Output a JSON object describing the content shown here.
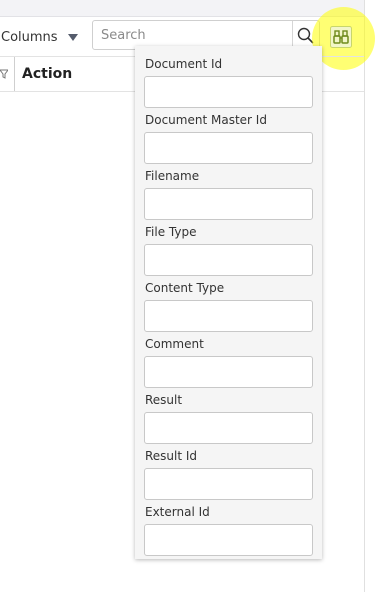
{
  "toolbar": {
    "columns_label": "Columns",
    "search_placeholder": "Search",
    "search_value": "",
    "advanced_search_icon": "binoculars-icon",
    "highlight_color": "#ffff00"
  },
  "table": {
    "action_header": "Action"
  },
  "filter_panel": {
    "fields": [
      {
        "label": "Document Id",
        "value": ""
      },
      {
        "label": "Document Master Id",
        "value": ""
      },
      {
        "label": "Filename",
        "value": ""
      },
      {
        "label": "File Type",
        "value": ""
      },
      {
        "label": "Content Type",
        "value": ""
      },
      {
        "label": "Comment",
        "value": ""
      },
      {
        "label": "Result",
        "value": ""
      },
      {
        "label": "Result Id",
        "value": ""
      },
      {
        "label": "External Id",
        "value": ""
      }
    ]
  }
}
